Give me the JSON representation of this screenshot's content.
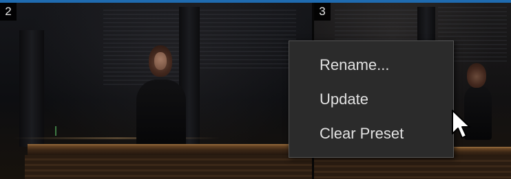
{
  "panels": [
    {
      "number": "2"
    },
    {
      "number": "3"
    }
  ],
  "context_menu": {
    "items": [
      {
        "label": "Rename..."
      },
      {
        "label": "Update"
      },
      {
        "label": "Clear Preset"
      }
    ]
  },
  "colors": {
    "accent_bar": "#1f6bb0",
    "menu_background": "#2b2b2b",
    "menu_text": "#e2e2e2",
    "badge_background": "#000000",
    "badge_text": "#e6e6e6"
  },
  "icons": {
    "pointer": "mouse-pointer-icon"
  }
}
